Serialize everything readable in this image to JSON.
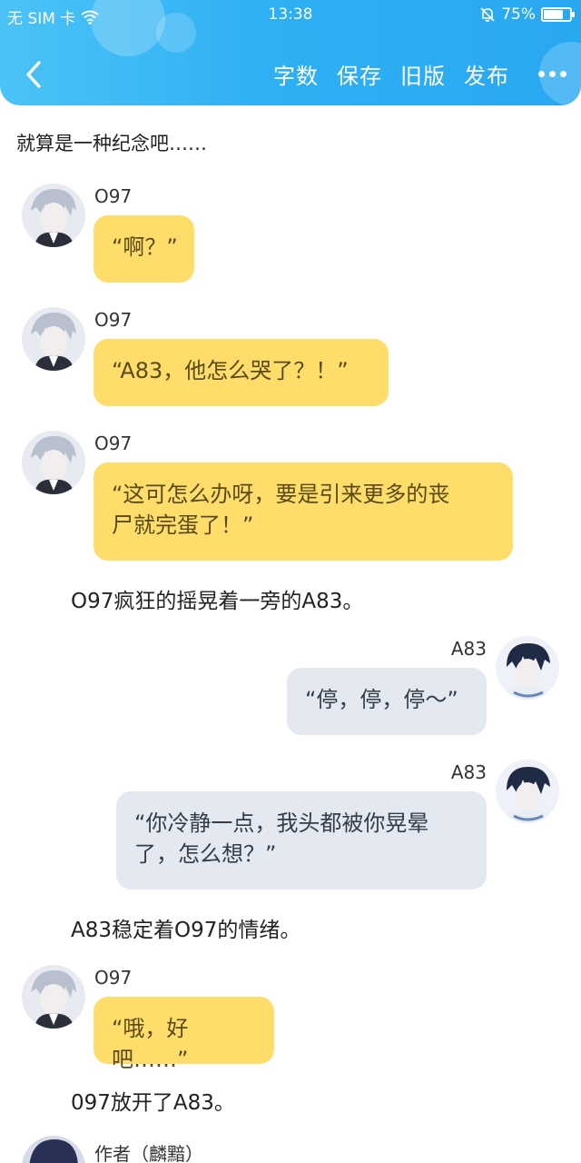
{
  "status_bar": {
    "carrier": "无 SIM 卡",
    "time": "13:38",
    "battery": "75%",
    "battery_level": 0.75
  },
  "header": {
    "back_icon": "chevron-left-icon",
    "actions": [
      "字数",
      "保存",
      "旧版",
      "发布"
    ],
    "more_icon": "more-dots-icon"
  },
  "messages": {
    "intro": "就算是一种纪念吧……",
    "m1_name": "O97",
    "m1_text": "“啊？”",
    "m2_name": "O97",
    "m2_text": "“A83，他怎么哭了？！”",
    "m3_name": "O97",
    "m3_text_line1": "“这可怎么办呀，要是引来更多的丧",
    "m3_text_line2": "尸就完蛋了！”",
    "narr1": "O97疯狂的摇晃着一旁的A83。",
    "m4_name": "A83",
    "m4_text": "“停，停，停～”",
    "m5_name": "A83",
    "m5_text_line1": "“你冷静一点，我头都被你晃晕",
    "m5_text_line2": "了，怎么想？”",
    "narr2": "A83稳定着O97的情绪。",
    "m6_name": "O97",
    "m6_text": "“哦，好吧……”",
    "narr3": "097放开了A83。",
    "m7_name": "作者（麟黯）"
  },
  "colors": {
    "header_gradient": [
      "#4cc3f6",
      "#29a8f2"
    ],
    "bubble_left": "#ffdd6a",
    "bubble_right": "#e4e9f1"
  }
}
